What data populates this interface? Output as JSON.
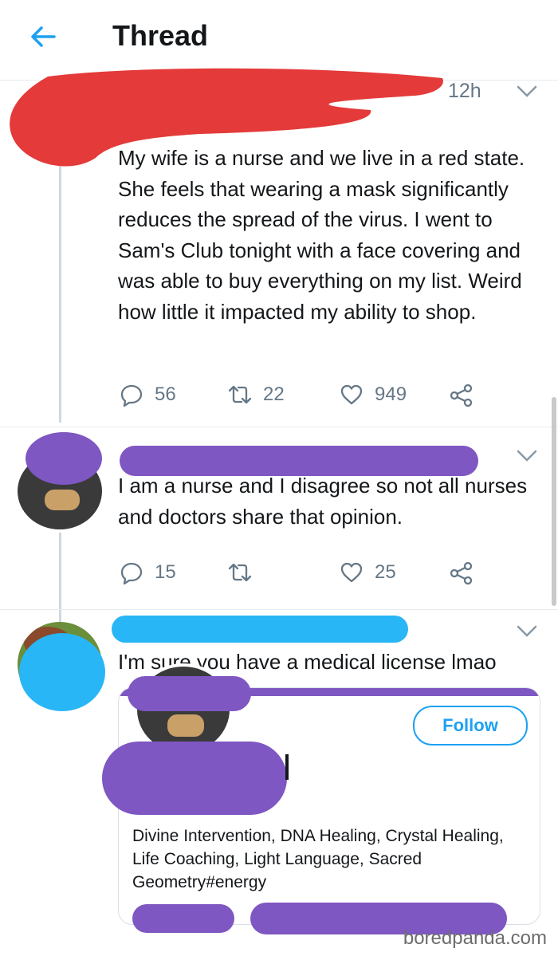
{
  "header": {
    "title": "Thread"
  },
  "tweets": [
    {
      "time": "12h",
      "text": "My wife is a nurse and we live in a red state. She feels that wearing a mask significantly reduces the spread of the virus. I went to Sam's Club tonight with a face covering and was able to buy everything on my list. Weird how little it impacted my ability to shop.",
      "replies": "56",
      "retweets": "22",
      "likes": "949"
    },
    {
      "text": "I am a nurse and I disagree so not all nurses and doctors share that opinion.",
      "replies": "15",
      "likes": "25"
    },
    {
      "text": "I'm sure you have a medical license lmao",
      "card": {
        "follow_label": "Follow",
        "bio": "Divine Intervention, DNA Healing, Crystal Healing, Life Coaching, Light Language, Sacred Geometry#energy"
      }
    }
  ],
  "watermark": "boredpanda.com",
  "colors": {
    "accent": "#1da1f2",
    "red_redaction": "#e43a3a",
    "purple_redaction": "#7e57c2",
    "blue_redaction": "#29b6f6"
  }
}
